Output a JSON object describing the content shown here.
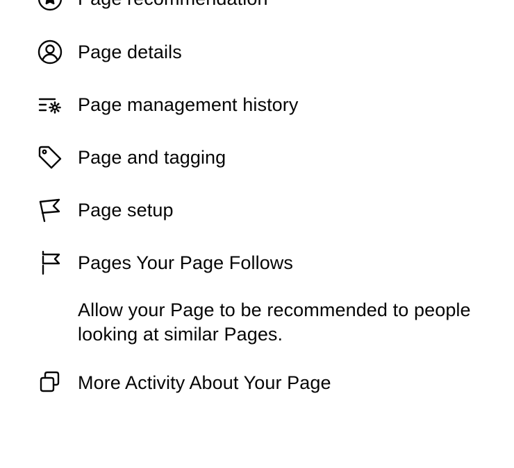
{
  "menu": {
    "items": [
      {
        "id": "page-recommendation",
        "label": "Page recommendation",
        "icon": "star-badge-icon"
      },
      {
        "id": "page-details",
        "label": "Page details",
        "icon": "person-circle-icon"
      },
      {
        "id": "page-management-history",
        "label": "Page management history",
        "icon": "list-gear-icon"
      },
      {
        "id": "page-and-tagging",
        "label": "Page and tagging",
        "icon": "tag-icon"
      },
      {
        "id": "page-setup",
        "label": "Page setup",
        "icon": "flag-icon"
      },
      {
        "id": "pages-your-page-follows",
        "label": "Pages Your Page Follows",
        "icon": "flag-post-icon"
      },
      {
        "id": "more-activity",
        "label": "More Activity About Your Page",
        "icon": "stacked-squares-icon"
      }
    ],
    "follows_description": "Allow your Page to be recommended to people looking at similar Pages."
  }
}
